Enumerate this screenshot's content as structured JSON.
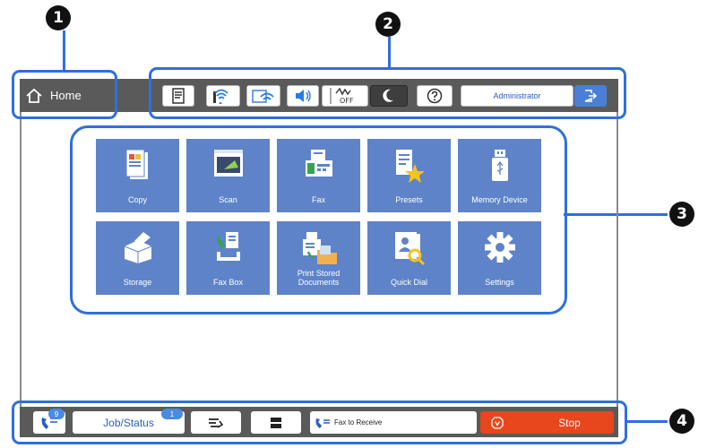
{
  "callouts": [
    "1",
    "2",
    "3",
    "4"
  ],
  "top_bar": {
    "home_label": "Home",
    "admin_label": "Administrator",
    "icons": [
      "paper-setting-icon",
      "wifi-direct-icon",
      "wifi-icon",
      "volume-icon",
      "quiet-mode-off-icon",
      "sleep-icon",
      "help-icon",
      "logout-icon"
    ]
  },
  "apps": [
    {
      "label": "Copy",
      "icon": "copy-icon"
    },
    {
      "label": "Scan",
      "icon": "scan-icon"
    },
    {
      "label": "Fax",
      "icon": "fax-icon"
    },
    {
      "label": "Presets",
      "icon": "presets-icon"
    },
    {
      "label": "Memory Device",
      "icon": "memory-device-icon"
    },
    {
      "label": "Storage",
      "icon": "storage-icon"
    },
    {
      "label": "Fax Box",
      "icon": "fax-box-icon"
    },
    {
      "label_line1": "Print Stored",
      "label_line2": "Documents",
      "icon": "print-stored-documents-icon"
    },
    {
      "label": "Quick Dial",
      "icon": "quick-dial-icon"
    },
    {
      "label": "Settings",
      "icon": "settings-icon"
    }
  ],
  "bottom_bar": {
    "fax_badge": "9",
    "job_status_label": "Job/Status",
    "job_badge": "1",
    "fax_to_receive_label": "Fax to Receive",
    "stop_label": "Stop"
  },
  "colors": {
    "tile": "#5e83c8",
    "highlight": "#2f6fdc",
    "stop": "#e8461c",
    "bar": "#5a5a5a"
  }
}
